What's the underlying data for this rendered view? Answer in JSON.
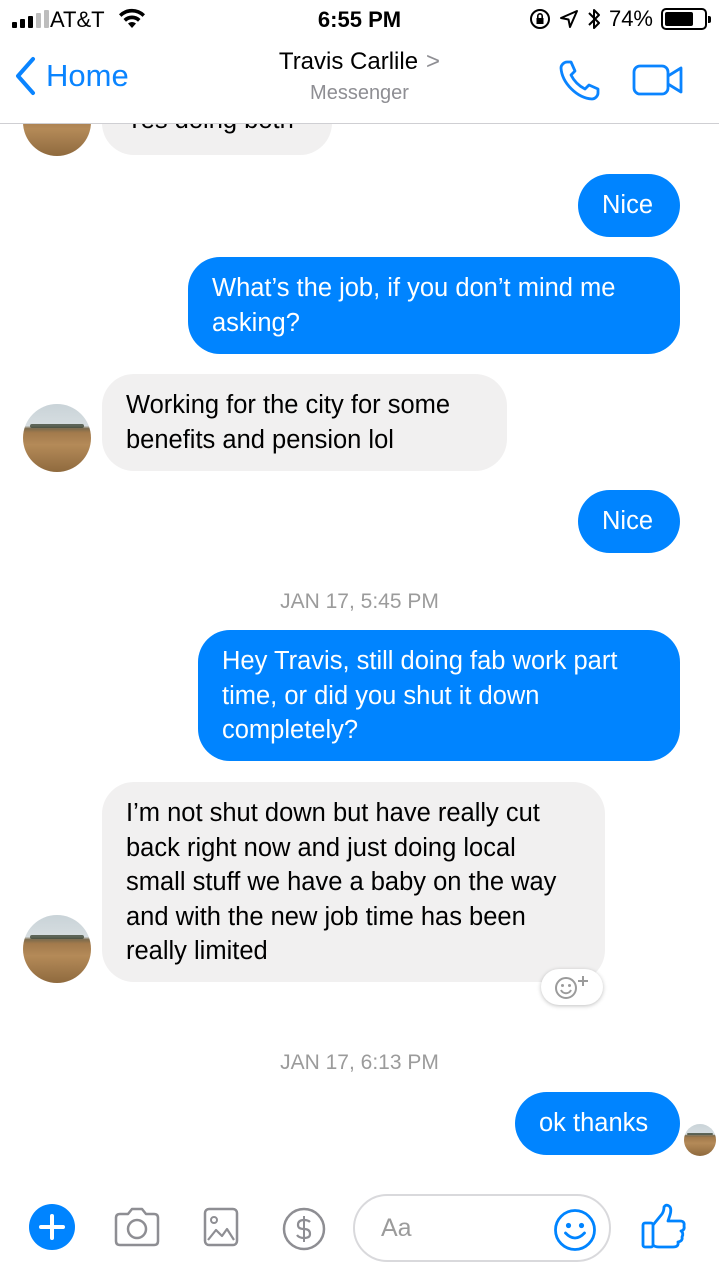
{
  "status_bar": {
    "carrier": "AT&T",
    "time": "6:55 PM",
    "battery": "74%",
    "battery_level": 0.74,
    "icons": [
      "signal-icon",
      "wifi-icon",
      "orientation-lock-icon",
      "location-icon",
      "bluetooth-icon",
      "battery-icon"
    ]
  },
  "header": {
    "back_label": "Home",
    "contact_name": "Travis Carlile",
    "contact_chevron": ">",
    "subtitle": "Messenger",
    "icons": [
      "back-chevron-icon",
      "phone-icon",
      "video-camera-icon"
    ]
  },
  "conversation": {
    "messages": [
      {
        "direction": "incoming",
        "text": "Yes doing both"
      },
      {
        "direction": "outgoing",
        "text": "Nice"
      },
      {
        "direction": "outgoing",
        "text": "What’s the job, if you don’t mind me asking?"
      },
      {
        "direction": "incoming",
        "text": "Working for the city for some benefits and pension lol"
      },
      {
        "direction": "outgoing",
        "text": "Nice"
      },
      {
        "type": "timestamp",
        "text": "JAN 17, 5:45 PM"
      },
      {
        "direction": "outgoing",
        "text": "Hey Travis, still doing fab work part time, or did you shut it down completely?"
      },
      {
        "direction": "incoming",
        "text": "I’m not shut down but have really cut back right now and just doing local small stuff we have a baby on the way and with the new job time has been really limited"
      },
      {
        "type": "timestamp",
        "text": "JAN 17, 6:13 PM"
      },
      {
        "direction": "outgoing",
        "text": "ok thanks",
        "seen": true
      }
    ],
    "reaction_icon": "add-reaction-icon"
  },
  "composer": {
    "placeholder": "Aa",
    "value": "",
    "icons": [
      "plus-icon",
      "camera-icon",
      "gallery-icon",
      "payment-dollar-icon",
      "emoji-icon",
      "thumbs-up-icon"
    ]
  },
  "colors": {
    "accent": "#0084ff",
    "ios_blue": "#0a84ff",
    "incoming_bubble": "#f1f0f0",
    "timestamp": "#9b9b9b"
  }
}
